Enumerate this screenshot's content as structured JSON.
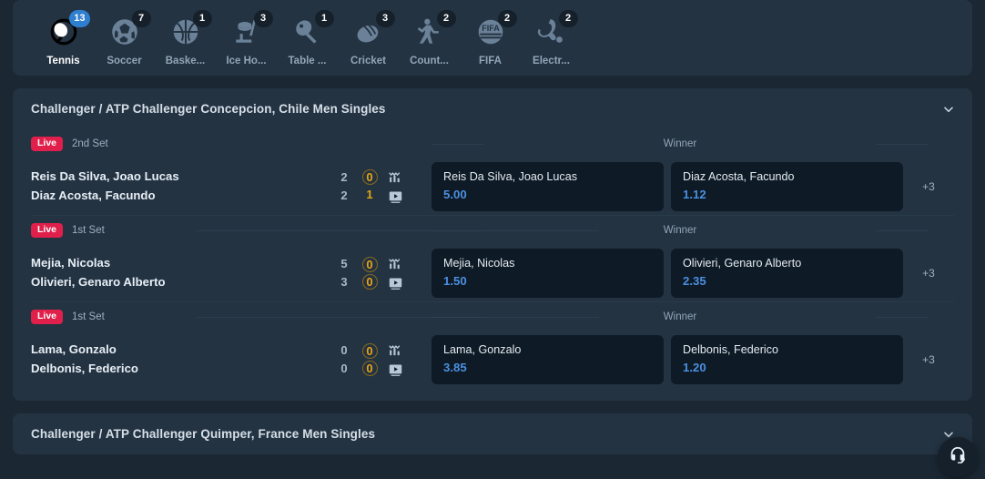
{
  "sports_nav": {
    "items": [
      {
        "label": "Tennis",
        "count": "13",
        "icon": "tennis-ball-icon",
        "active": true
      },
      {
        "label": "Soccer",
        "count": "7",
        "icon": "soccer-ball-icon",
        "active": false
      },
      {
        "label": "Baske...",
        "count": "1",
        "icon": "basketball-icon",
        "active": false
      },
      {
        "label": "Ice Ho...",
        "count": "3",
        "icon": "ice-hockey-icon",
        "active": false
      },
      {
        "label": "Table ...",
        "count": "1",
        "icon": "table-tennis-icon",
        "active": false
      },
      {
        "label": "Cricket",
        "count": "3",
        "icon": "cricket-ball-icon",
        "active": false
      },
      {
        "label": "Count...",
        "count": "2",
        "icon": "counter-strike-icon",
        "active": false
      },
      {
        "label": "FIFA",
        "count": "2",
        "icon": "fifa-icon",
        "active": false
      },
      {
        "label": "Electr...",
        "count": "2",
        "icon": "electronic-sports-icon",
        "active": false
      }
    ]
  },
  "leagues": [
    {
      "title": "Challenger / ATP Challenger Concepcion, Chile Men Singles",
      "collapse_icon": "chevron-down-icon",
      "matches": [
        {
          "live_label": "Live",
          "period": "2nd Set",
          "market_title": "Winner",
          "more_markets": "+3",
          "stats_icon": "statistics-icon",
          "video_icon": "live-video-icon",
          "competitors": [
            {
              "name": "Reis Da Silva, Joao Lucas",
              "sets": "2",
              "games": "0",
              "serving": true,
              "odds": "5.00"
            },
            {
              "name": "Diaz Acosta, Facundo",
              "sets": "2",
              "games": "1",
              "serving": false,
              "odds": "1.12"
            }
          ]
        },
        {
          "live_label": "Live",
          "period": "1st Set",
          "market_title": "Winner",
          "more_markets": "+3",
          "stats_icon": "statistics-icon",
          "video_icon": "live-video-icon",
          "competitors": [
            {
              "name": "Mejia, Nicolas",
              "sets": "5",
              "games": "0",
              "serving": true,
              "odds": "1.50"
            },
            {
              "name": "Olivieri, Genaro Alberto",
              "sets": "3",
              "games": "0",
              "serving": true,
              "odds": "2.35"
            }
          ]
        },
        {
          "live_label": "Live",
          "period": "1st Set",
          "market_title": "Winner",
          "more_markets": "+3",
          "stats_icon": "statistics-icon",
          "video_icon": "live-video-icon",
          "competitors": [
            {
              "name": "Lama, Gonzalo",
              "sets": "0",
              "games": "0",
              "serving": true,
              "odds": "3.85"
            },
            {
              "name": "Delbonis, Federico",
              "sets": "0",
              "games": "0",
              "serving": true,
              "odds": "1.20"
            }
          ]
        }
      ]
    },
    {
      "title": "Challenger / ATP Challenger Quimper, France Men Singles",
      "collapse_icon": "chevron-down-icon",
      "matches": []
    }
  ],
  "support": {
    "icon": "headset-support-icon"
  },
  "colors": {
    "page_bg": "#1b2733",
    "card_bg": "#233342",
    "odds_bg": "#0e1a25",
    "live_red": "#e0204b",
    "odds_blue": "#4b90e2",
    "score_orange": "#e8a317",
    "badge_blue": "#2f7fd1"
  }
}
